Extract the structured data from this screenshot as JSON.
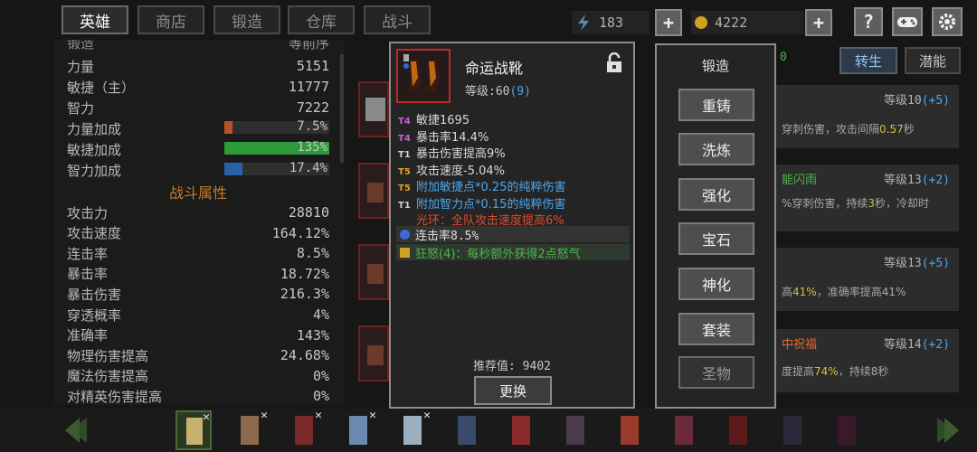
{
  "nav": {
    "tabs": [
      "英雄",
      "商店",
      "锻造",
      "仓库",
      "战斗"
    ]
  },
  "resources": {
    "energy": "183",
    "gold": "4222",
    "plus": "+",
    "help": "?"
  },
  "stats_top": {
    "cut_label": "锻造",
    "cut_value": "等前序"
  },
  "stats": [
    {
      "label": "力量",
      "value": "5151"
    },
    {
      "label": "敏捷（主）",
      "value": "11777"
    },
    {
      "label": "智力",
      "value": "7222"
    }
  ],
  "bonus": [
    {
      "label": "力量加成",
      "value": "7.5%",
      "percent": 7.5,
      "color": "#b5532a"
    },
    {
      "label": "敏捷加成",
      "value": "135%",
      "percent": 100,
      "color": "#2f9a3a"
    },
    {
      "label": "智力加成",
      "value": "17.4%",
      "percent": 17.4,
      "color": "#2a62a8"
    }
  ],
  "combat_title": "战斗属性",
  "combat": [
    {
      "label": "攻击力",
      "value": "28810"
    },
    {
      "label": "攻击速度",
      "value": "164.12%"
    },
    {
      "label": "连击率",
      "value": "8.5%"
    },
    {
      "label": "暴击率",
      "value": "18.72%"
    },
    {
      "label": "暴击伤害",
      "value": "216.3%"
    },
    {
      "label": "穿透概率",
      "value": "4%"
    },
    {
      "label": "准确率",
      "value": "143%"
    },
    {
      "label": "物理伤害提高",
      "value": "24.68%"
    },
    {
      "label": "魔法伤害提高",
      "value": "0%"
    },
    {
      "label": "对精英伤害提高",
      "value": "0%"
    }
  ],
  "item": {
    "name": "命运战靴",
    "level_label": "等级:60",
    "level_extra": "(9)",
    "lines": [
      {
        "tier": "T4",
        "tcolor": "#c864d8",
        "text": "敏捷1695",
        "color": "#d8d8d8"
      },
      {
        "tier": "T4",
        "tcolor": "#c864d8",
        "text": "暴击率14.4%",
        "color": "#d8d8d8"
      },
      {
        "tier": "T1",
        "tcolor": "#cfcfcf",
        "text": "暴击伤害提高9%",
        "color": "#d8d8d8"
      },
      {
        "tier": "T5",
        "tcolor": "#e0a020",
        "text": "攻击速度-5.04%",
        "color": "#d8d8d8"
      },
      {
        "tier": "T5",
        "tcolor": "#e0a020",
        "text": "附加敏捷点*0.25的纯粹伤害",
        "color": "#4aa8f0"
      },
      {
        "tier": "T1",
        "tcolor": "#cfcfcf",
        "text": "附加智力点*0.15的纯粹伤害",
        "color": "#4aa8f0"
      },
      {
        "tier": "",
        "tcolor": "#cfcfcf",
        "text": "光环：全队攻击速度提高6%",
        "color": "#e04a2a"
      }
    ],
    "gem_text": "连击率8.5%",
    "set_text": "狂怒(4)：每秒额外获得2点怒气",
    "recommend": "推荐值: 9402",
    "replace": "更换"
  },
  "forge": {
    "title": "锻造",
    "buttons": [
      "重铸",
      "洗炼",
      "强化",
      "宝石",
      "神化",
      "套装",
      "圣物"
    ]
  },
  "right_tabs": {
    "count": "0",
    "tab1": "转生",
    "tab2": "潜能"
  },
  "skills": [
    {
      "level": "等级10",
      "plus": "(+5)",
      "text_a": "穿刺伤害，攻击间隔",
      "num": "0.57",
      "text_b": "秒",
      "name": ""
    },
    {
      "level": "等级13",
      "plus": "(+2)",
      "text_a": "%穿刺伤害，持续",
      "num": "3",
      "text_b": "秒，冷却时",
      "name": "能闪雨"
    },
    {
      "level": "等级13",
      "plus": "(+5)",
      "text_a": "高",
      "num": "41%",
      "text_b": "，准确率提高41%",
      "name": ""
    },
    {
      "level": "等级14",
      "plus": "(+2)",
      "text_a": "度提高",
      "num": "74%",
      "text_b": "，持续8秒",
      "name": "中祝福"
    }
  ]
}
